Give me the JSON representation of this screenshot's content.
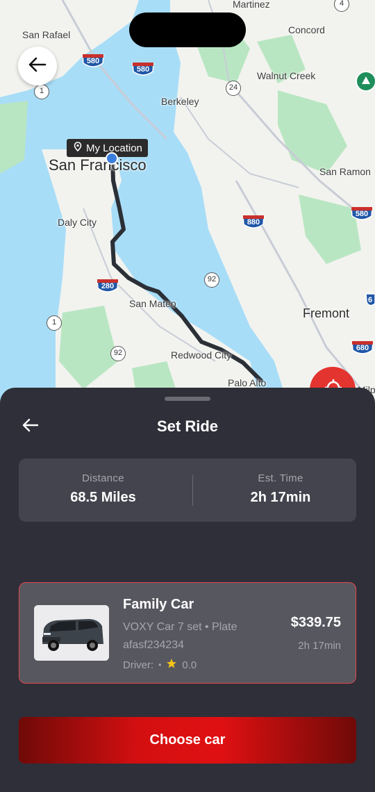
{
  "map": {
    "my_location_label": "My Location",
    "places": [
      {
        "name": "San Rafael",
        "size": "normal"
      },
      {
        "name": "Martinez",
        "size": "normal"
      },
      {
        "name": "Concord",
        "size": "normal"
      },
      {
        "name": "Walnut Creek",
        "size": "normal"
      },
      {
        "name": "Berkeley",
        "size": "normal"
      },
      {
        "name": "San Francisco",
        "size": "big"
      },
      {
        "name": "San Ramon",
        "size": "normal"
      },
      {
        "name": "Daly City",
        "size": "normal"
      },
      {
        "name": "San Mateo",
        "size": "normal"
      },
      {
        "name": "Fremont",
        "size": "med"
      },
      {
        "name": "Redwood City",
        "size": "normal"
      },
      {
        "name": "Palo Alto",
        "size": "normal"
      },
      {
        "name": "Milp",
        "size": "normal"
      }
    ],
    "shields": [
      "580",
      "580",
      "880",
      "580",
      "280",
      "680",
      "6"
    ],
    "circle_routes": [
      "4",
      "1",
      "24",
      "92",
      "1",
      "92"
    ],
    "colors": {
      "water": "#a8ddf7",
      "land": "#f2f3ef",
      "park": "#b9e6c2",
      "route": "#2b2f36",
      "accent_red": "#e3342f"
    }
  },
  "sheet": {
    "title": "Set Ride",
    "stats": {
      "distance_label": "Distance",
      "distance_value": "68.5 Miles",
      "time_label": "Est. Time",
      "time_value": "2h 17min"
    },
    "car": {
      "name": "Family Car",
      "description": "VOXY Car 7 set • Plate afasf234234",
      "driver_label": "Driver:",
      "driver_separator": "•",
      "rating": "0.0",
      "price": "$339.75",
      "duration": "2h 17min"
    },
    "choose_button": "Choose car",
    "colors": {
      "sheet_bg": "#2f2f39",
      "card_bg": "#44444e",
      "selected_border": "#e2484c",
      "button_red": "#d30f10"
    }
  }
}
